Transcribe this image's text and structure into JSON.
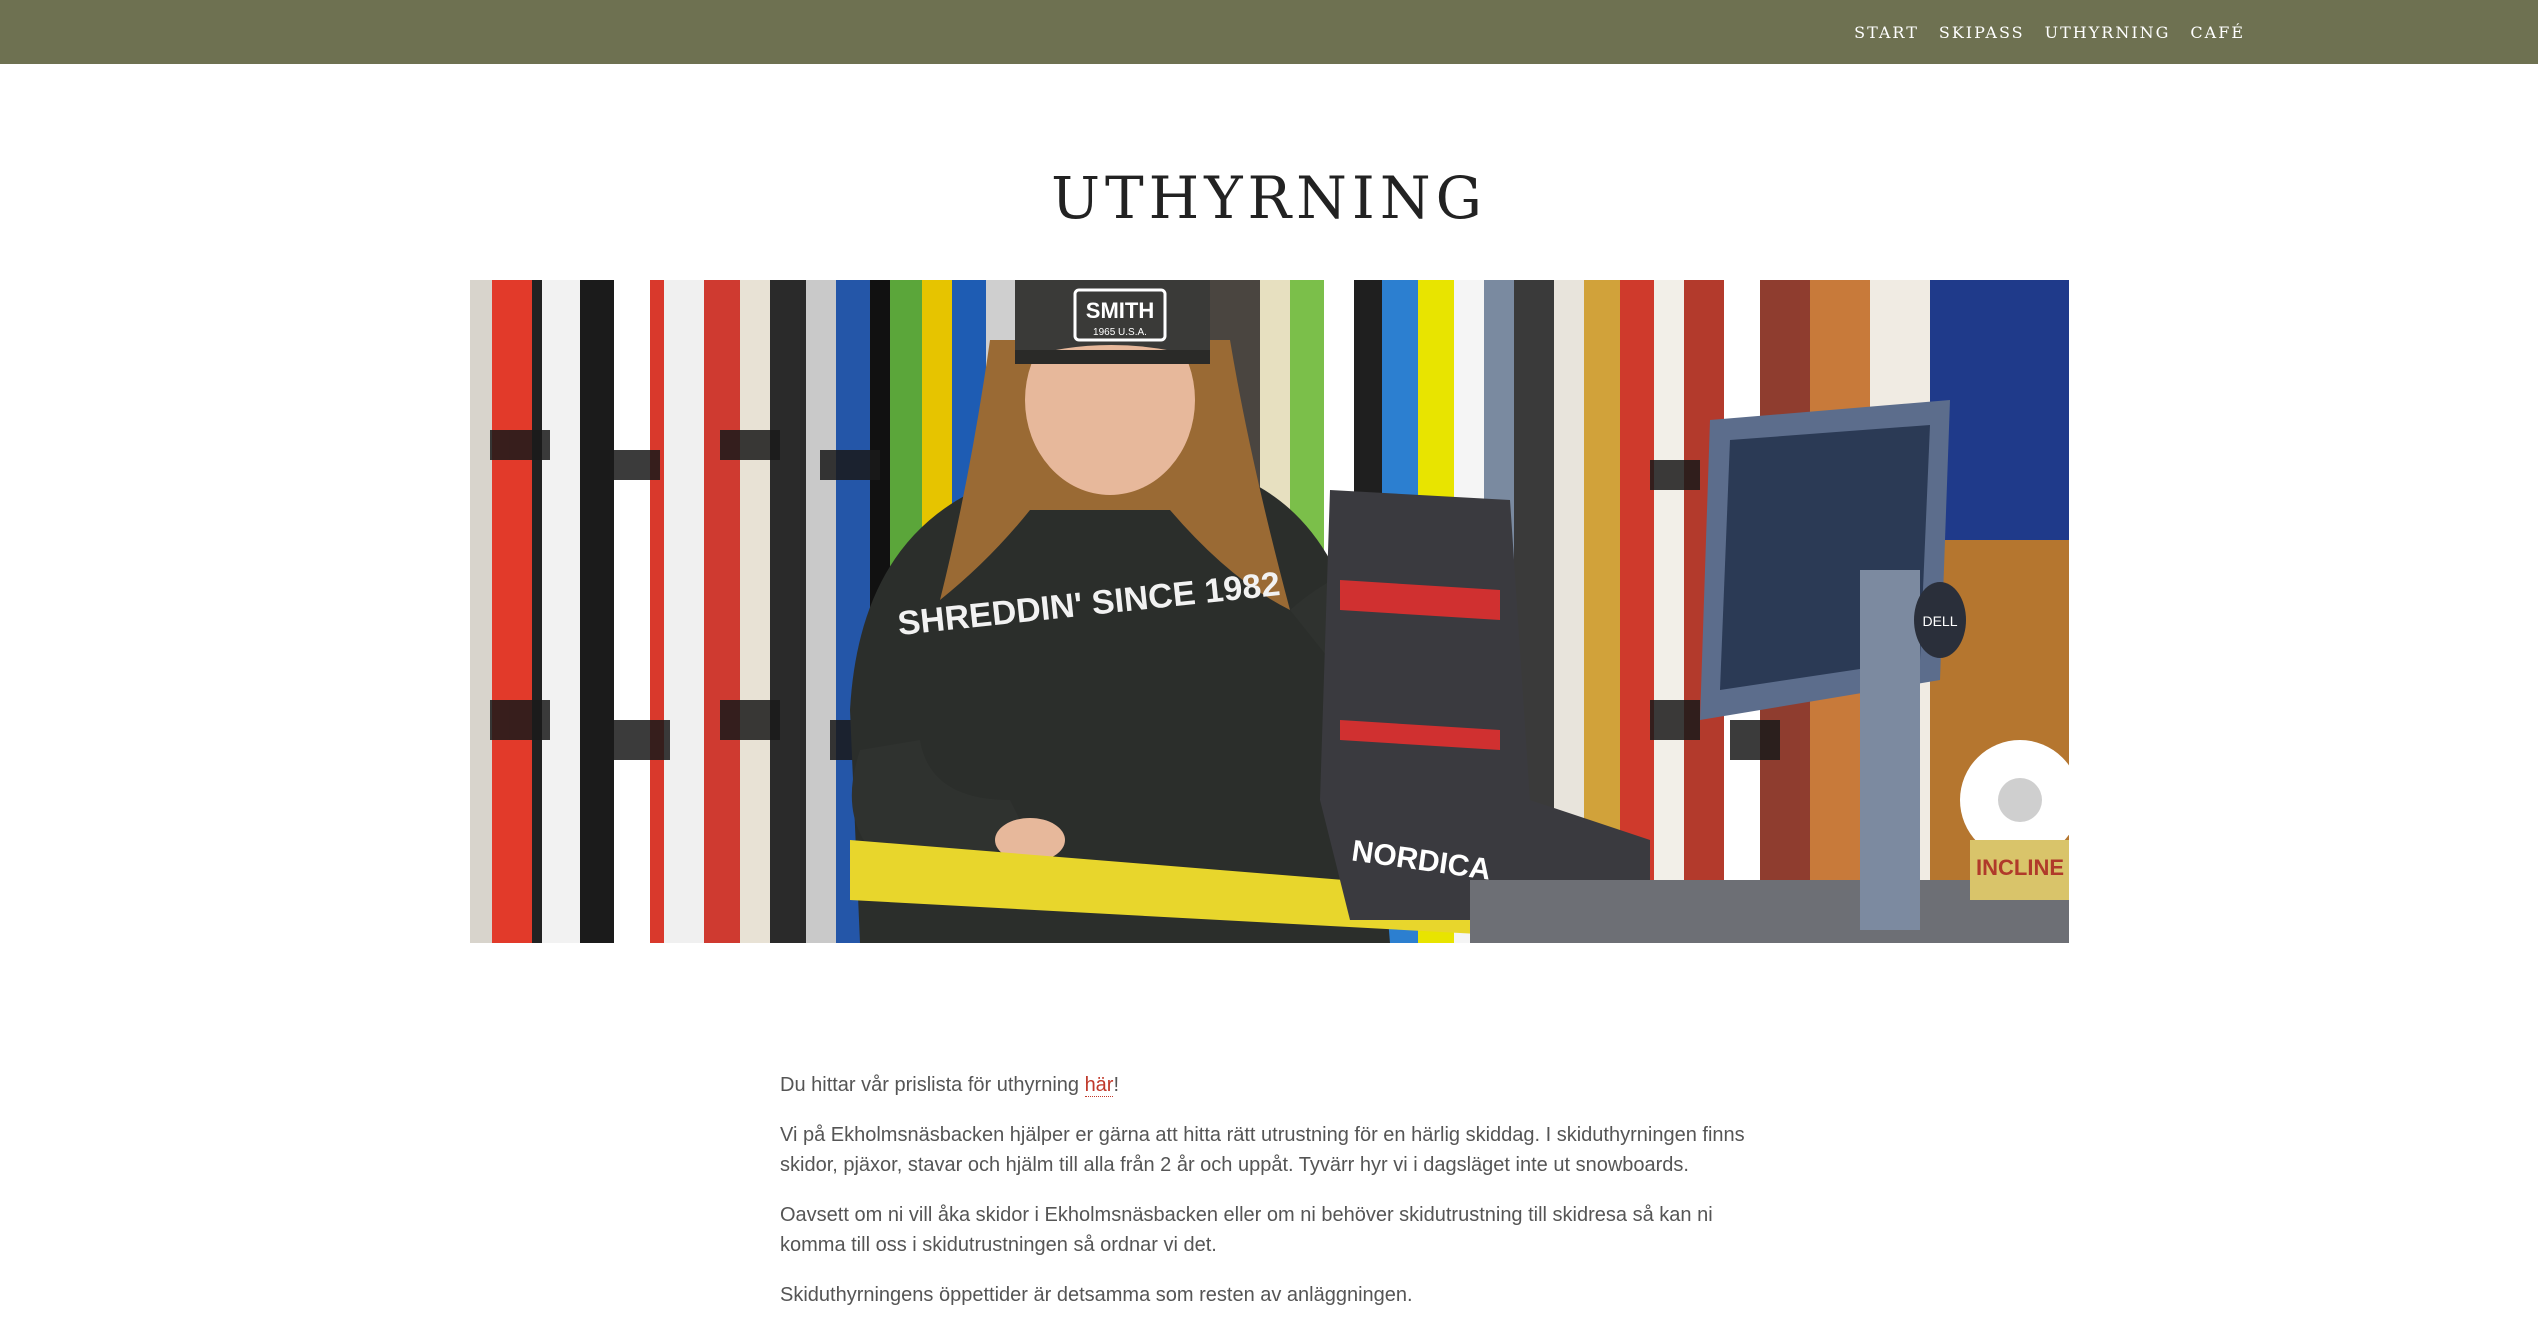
{
  "nav": {
    "items": [
      {
        "label": "START"
      },
      {
        "label": "SKIPASS"
      },
      {
        "label": "UTHYRNING"
      },
      {
        "label": "CAFÉ"
      }
    ]
  },
  "page": {
    "title": "UTHYRNING"
  },
  "hero": {
    "cap_brand": "SMITH",
    "cap_sub": "1965 U.S.A.",
    "hoodie_text": "SHREDDIN' SINCE 1982",
    "boot_brand": "NORDICA",
    "monitor_brand": "DELL",
    "sticker_text": "INCLINE"
  },
  "content": {
    "p1_before": "Du hittar vår prislista för uthyrning ",
    "p1_link": "här",
    "p1_after": "!",
    "p2": "Vi på Ekholmsnäsbacken hjälper er gärna att hitta rätt utrustning för en härlig skiddag. I skiduthyrningen finns skidor, pjäxor, stavar och hjälm till alla från 2 år och uppåt. Tyvärr hyr vi i dagsläget inte ut snowboards.",
    "p3": "Oavsett om ni vill åka skidor i Ekholmsnäsbacken eller om ni behöver skidutrustning till skidresa så kan ni komma till oss i skidutrustningen så ordnar vi det.",
    "p4": "Skiduthyrningens öppettider är detsamma som resten av anläggningen."
  },
  "colors": {
    "topbar": "#6e7151",
    "link": "#c0392b",
    "text": "#555555"
  }
}
